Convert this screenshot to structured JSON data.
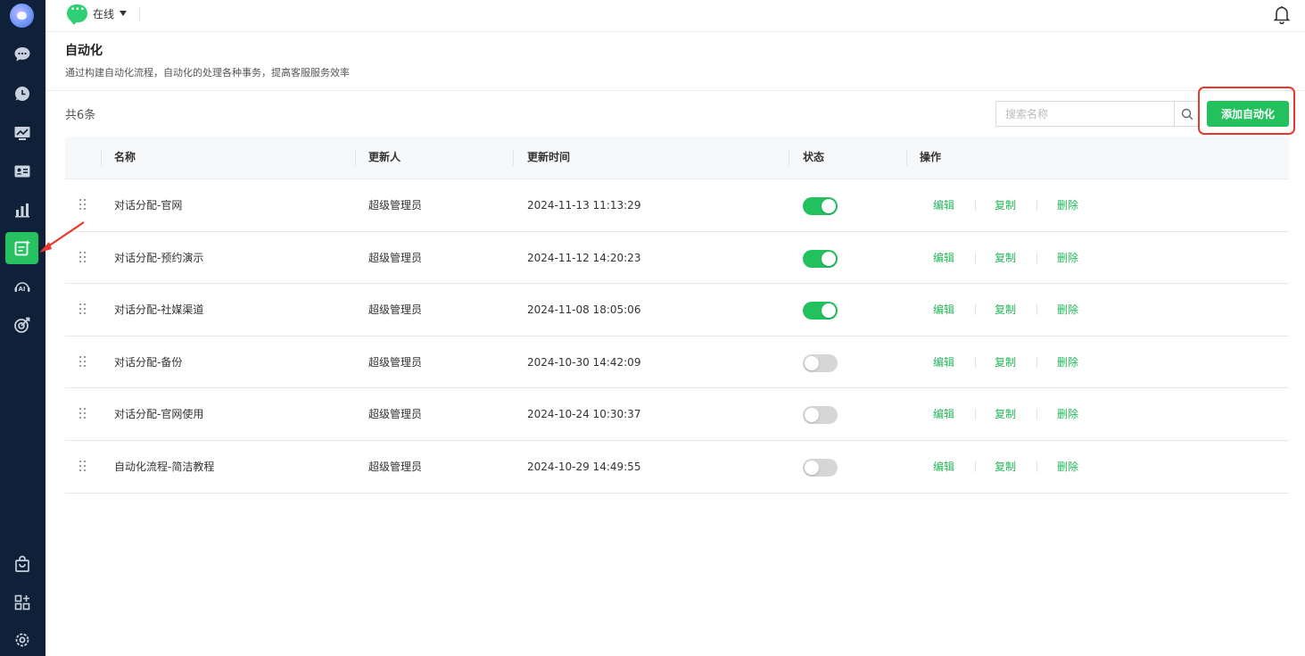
{
  "topbar": {
    "status_label": "在线"
  },
  "page": {
    "title": "自动化",
    "description": "通过构建自动化流程，自动化的处理各种事务，提高客服服务效率"
  },
  "toolbar": {
    "total_label": "共6条",
    "search_placeholder": "搜索名称",
    "add_button_label": "添加自动化"
  },
  "table": {
    "columns": {
      "name": "名称",
      "updater": "更新人",
      "updated_at": "更新时间",
      "status": "状态",
      "actions": "操作"
    },
    "rows": [
      {
        "name": "对话分配-官网",
        "updater": "超级管理员",
        "updated_at": "2024-11-13 11:13:29",
        "enabled": true
      },
      {
        "name": "对话分配-预约演示",
        "updater": "超级管理员",
        "updated_at": "2024-11-12 14:20:23",
        "enabled": true
      },
      {
        "name": "对话分配-社媒渠道",
        "updater": "超级管理员",
        "updated_at": "2024-11-08 18:05:06",
        "enabled": true
      },
      {
        "name": "对话分配-备份",
        "updater": "超级管理员",
        "updated_at": "2024-10-30 14:42:09",
        "enabled": false
      },
      {
        "name": "对话分配-官网使用",
        "updater": "超级管理员",
        "updated_at": "2024-10-24 10:30:37",
        "enabled": false
      },
      {
        "name": "自动化流程-简洁教程",
        "updater": "超级管理员",
        "updated_at": "2024-10-29 14:49:55",
        "enabled": false
      }
    ],
    "actions": {
      "edit": "编辑",
      "copy": "复制",
      "delete": "删除"
    }
  },
  "colors": {
    "sidebar_bg": "#0f2138",
    "accent_green": "#22c15d",
    "highlight_red": "#e8382e"
  },
  "sidebar": {
    "items": [
      {
        "icon": "chat-bubble-icon"
      },
      {
        "icon": "conversation-icon"
      },
      {
        "icon": "monitor-chart-icon"
      },
      {
        "icon": "contact-card-icon"
      },
      {
        "icon": "bar-chart-icon"
      },
      {
        "icon": "automation-icon",
        "active": true
      },
      {
        "icon": "ai-assistant-icon"
      },
      {
        "icon": "target-icon"
      },
      {
        "icon": "shopping-bag-icon"
      },
      {
        "icon": "apps-grid-icon"
      },
      {
        "icon": "settings-gear-icon"
      }
    ]
  }
}
